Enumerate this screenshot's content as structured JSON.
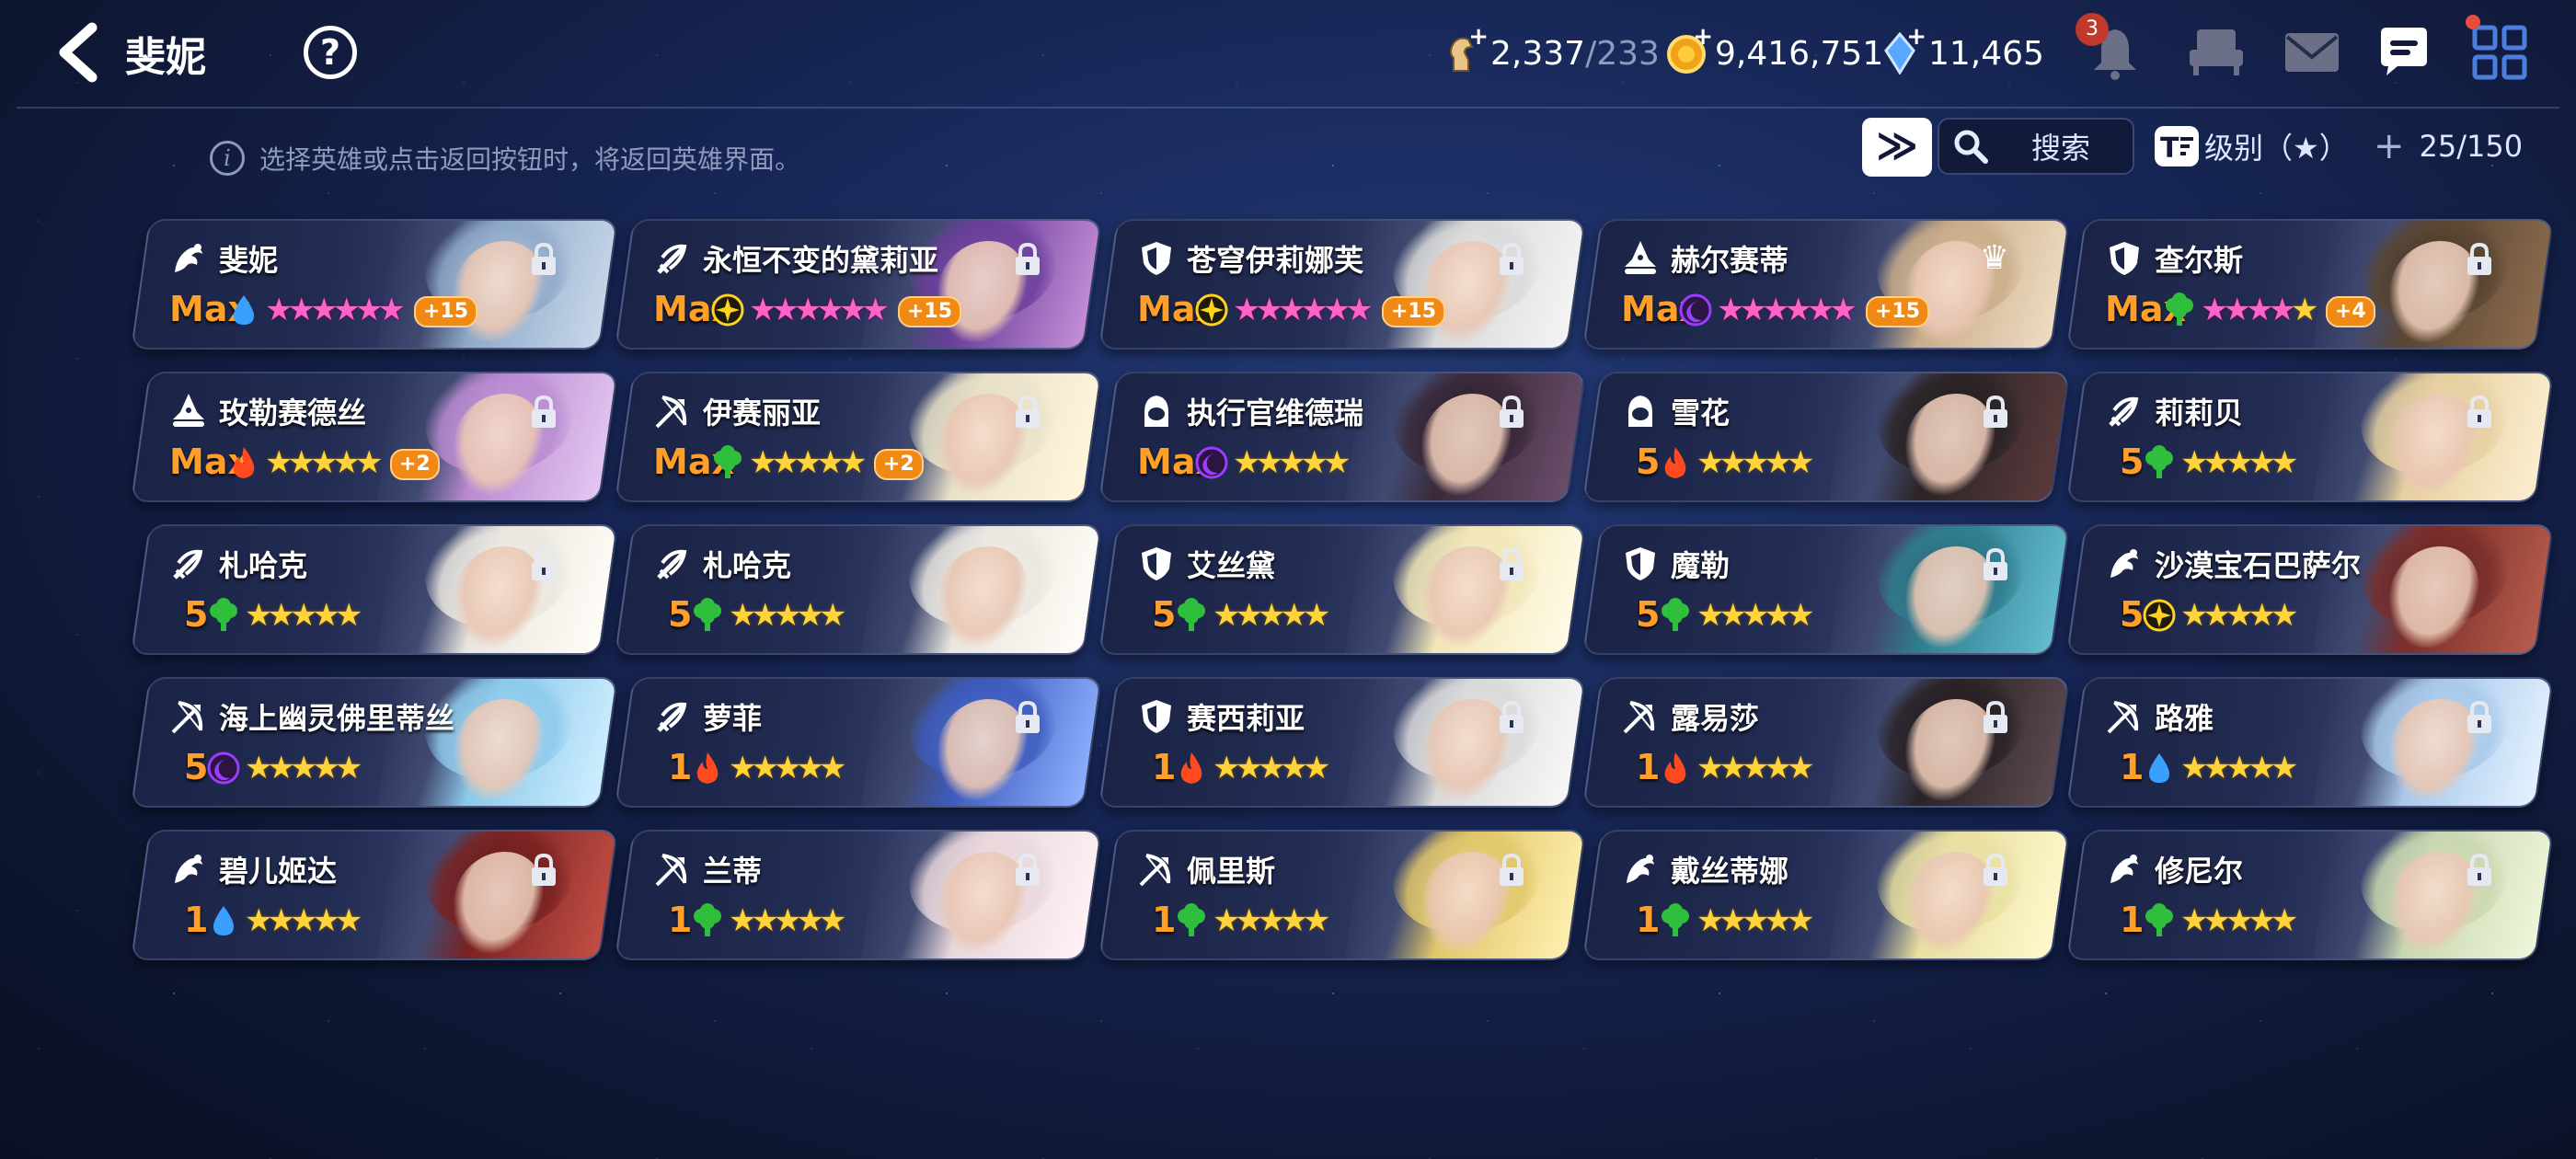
{
  "header": {
    "title": "斐妮",
    "help_glyph": "?",
    "resources": [
      {
        "name": "stamina",
        "icon": "horse-icon",
        "value": "2,337",
        "max": "/233"
      },
      {
        "name": "gold",
        "icon": "gold-coin-icon",
        "value": "9,416,751"
      },
      {
        "name": "crystal",
        "icon": "crystal-icon",
        "value": "11,465"
      }
    ],
    "notification_count": "3"
  },
  "hint": {
    "text": "选择英雄或点击返回按钮时，将返回英雄界面。"
  },
  "toolbar": {
    "skip_glyph": "≫",
    "search_label": "搜索",
    "sort_label": "级别（★）",
    "count": "25/150",
    "add_glyph": "+"
  },
  "colors": {
    "water": "#3aa0ff",
    "earth": "#2fbf3c",
    "fire": "#ff4a1f",
    "dark": "#9b3cff",
    "light": "#ffd21f",
    "max": "#ff9f2a"
  },
  "heroes": [
    {
      "name": "斐妮",
      "role": "mage",
      "level": "Max",
      "element": "water",
      "stars": 6,
      "pink": true,
      "plus": "+15",
      "lock": true
    },
    {
      "name": "永恒不变的黛莉亚",
      "role": "ranger",
      "level": "Max",
      "element": "light",
      "stars": 6,
      "pink": true,
      "plus": "+15",
      "lock": true
    },
    {
      "name": "苍穹伊莉娜芙",
      "role": "knight",
      "level": "Max",
      "element": "light",
      "stars": 6,
      "pink": true,
      "plus": "+15",
      "lock": true
    },
    {
      "name": "赫尔赛蒂",
      "role": "warlock",
      "level": "Max",
      "element": "dark",
      "stars": 6,
      "pink": true,
      "plus": "+15",
      "lock": false,
      "crown": true
    },
    {
      "name": "查尔斯",
      "role": "knight",
      "level": "Max",
      "element": "earth",
      "stars": 5,
      "pink": true,
      "plus": "+4",
      "lock": true
    },
    {
      "name": "玫勒赛德丝",
      "role": "warlock",
      "level": "Max",
      "element": "fire",
      "stars": 5,
      "pink": false,
      "plus": "+2",
      "lock": true
    },
    {
      "name": "伊赛丽亚",
      "role": "archer",
      "level": "Max",
      "element": "earth",
      "stars": 5,
      "pink": false,
      "plus": "+2",
      "lock": true
    },
    {
      "name": "执行官维德瑞",
      "role": "thief",
      "level": "Max",
      "element": "dark",
      "stars": 5,
      "pink": false,
      "plus": "",
      "lock": true
    },
    {
      "name": "雪花",
      "role": "thief",
      "level": "5",
      "element": "fire",
      "stars": 5,
      "pink": false,
      "plus": "",
      "lock": true
    },
    {
      "name": "莉莉贝",
      "role": "ranger",
      "level": "5",
      "element": "earth",
      "stars": 5,
      "pink": false,
      "plus": "",
      "lock": true
    },
    {
      "name": "札哈克",
      "role": "ranger",
      "level": "5",
      "element": "earth",
      "stars": 5,
      "pink": false,
      "plus": "",
      "lock": true
    },
    {
      "name": "札哈克",
      "role": "ranger",
      "level": "5",
      "element": "earth",
      "stars": 5,
      "pink": false,
      "plus": "",
      "lock": false
    },
    {
      "name": "艾丝黛",
      "role": "knight",
      "level": "5",
      "element": "earth",
      "stars": 5,
      "pink": false,
      "plus": "",
      "lock": true
    },
    {
      "name": "魔勒",
      "role": "knight",
      "level": "5",
      "element": "earth",
      "stars": 5,
      "pink": false,
      "plus": "",
      "lock": true
    },
    {
      "name": "沙漠宝石巴萨尔",
      "role": "mage",
      "level": "5",
      "element": "light",
      "stars": 5,
      "pink": false,
      "plus": "",
      "lock": false
    },
    {
      "name": "海上幽灵佛里蒂丝",
      "role": "archer",
      "level": "5",
      "element": "dark",
      "stars": 5,
      "pink": false,
      "plus": "",
      "lock": false
    },
    {
      "name": "萝菲",
      "role": "ranger",
      "level": "1",
      "element": "fire",
      "stars": 5,
      "pink": false,
      "plus": "",
      "lock": true
    },
    {
      "name": "赛西莉亚",
      "role": "knight",
      "level": "1",
      "element": "fire",
      "stars": 5,
      "pink": false,
      "plus": "",
      "lock": true
    },
    {
      "name": "露易莎",
      "role": "archer",
      "level": "1",
      "element": "fire",
      "stars": 5,
      "pink": false,
      "plus": "",
      "lock": true
    },
    {
      "name": "路雅",
      "role": "archer",
      "level": "1",
      "element": "water",
      "stars": 5,
      "pink": false,
      "plus": "",
      "lock": true
    },
    {
      "name": "碧儿姬达",
      "role": "mage",
      "level": "1",
      "element": "water",
      "stars": 5,
      "pink": false,
      "plus": "",
      "lock": true
    },
    {
      "name": "兰蒂",
      "role": "archer",
      "level": "1",
      "element": "earth",
      "stars": 5,
      "pink": false,
      "plus": "",
      "lock": true
    },
    {
      "name": "佩里斯",
      "role": "archer",
      "level": "1",
      "element": "earth",
      "stars": 5,
      "pink": false,
      "plus": "",
      "lock": true
    },
    {
      "name": "戴丝蒂娜",
      "role": "mage",
      "level": "1",
      "element": "earth",
      "stars": 5,
      "pink": false,
      "plus": "",
      "lock": true
    },
    {
      "name": "修尼尔",
      "role": "mage",
      "level": "1",
      "element": "earth",
      "stars": 5,
      "pink": false,
      "plus": "",
      "lock": true
    }
  ]
}
